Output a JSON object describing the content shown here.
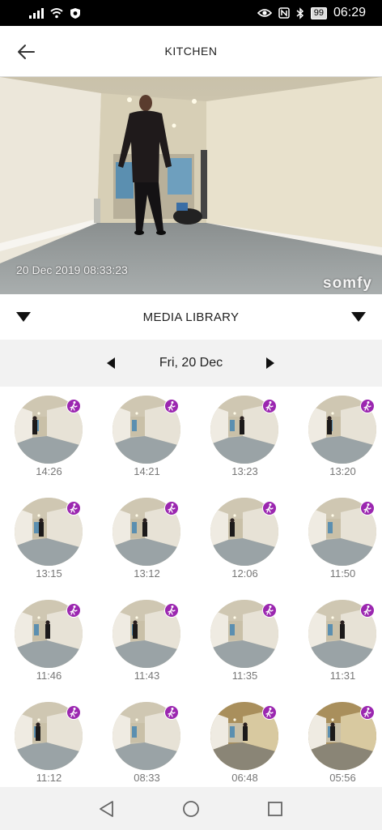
{
  "status_bar": {
    "battery": "99",
    "time": "06:29"
  },
  "header": {
    "title": "KITCHEN"
  },
  "camera": {
    "timestamp": "20 Dec 2019 08:33:23",
    "brand": "somfy"
  },
  "media_library": {
    "title": "MEDIA LIBRARY"
  },
  "date_selector": {
    "date": "Fri, 20 Dec"
  },
  "thumbnails": [
    {
      "time": "14:26"
    },
    {
      "time": "14:21"
    },
    {
      "time": "13:23"
    },
    {
      "time": "13:20"
    },
    {
      "time": "13:15"
    },
    {
      "time": "13:12"
    },
    {
      "time": "12:06"
    },
    {
      "time": "11:50"
    },
    {
      "time": "11:46"
    },
    {
      "time": "11:43"
    },
    {
      "time": "11:35"
    },
    {
      "time": "11:31"
    },
    {
      "time": "11:12"
    },
    {
      "time": "08:33"
    },
    {
      "time": "06:48"
    },
    {
      "time": "05:56"
    }
  ],
  "colors": {
    "badge": "#9b27b0",
    "header_bg": "#ffffff",
    "date_bar_bg": "#f2f2f2"
  },
  "icons": {
    "back": "arrow-left-icon",
    "motion": "person-walking-icon"
  }
}
